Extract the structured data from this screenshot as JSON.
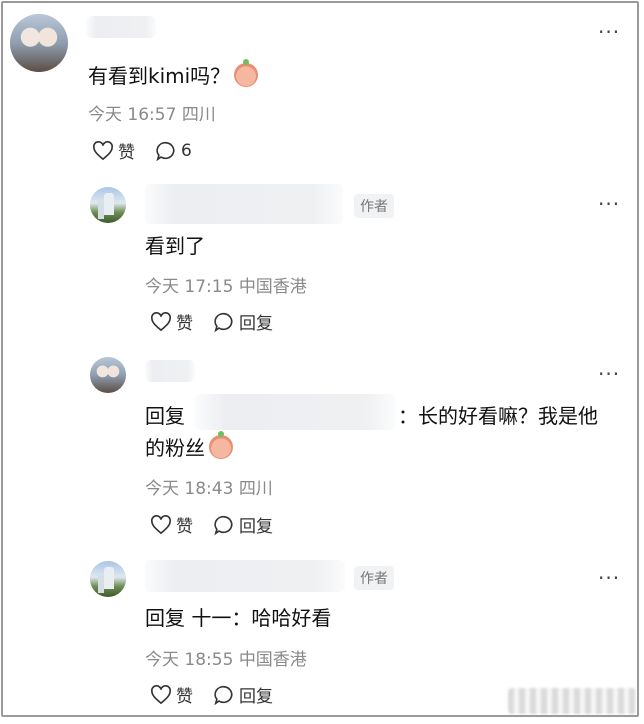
{
  "comments": [
    {
      "text": "有看到kimi吗？",
      "time": "今天 16:57",
      "location": "四川",
      "like_label": "赞",
      "reply_count": "6"
    }
  ],
  "replies": [
    {
      "badge": "作者",
      "text": "看到了",
      "time": "今天 17:15",
      "location": "中国香港",
      "like_label": "赞",
      "reply_label": "回复"
    },
    {
      "prefix": "回复",
      "text_line1_suffix": "：长的好看嘛？我是他",
      "text_line2": "的粉丝",
      "time": "今天 18:43",
      "location": "四川",
      "like_label": "赞",
      "reply_label": "回复"
    },
    {
      "badge": "作者",
      "text": "回复 十一：哈哈好看",
      "time": "今天 18:55",
      "location": "中国香港",
      "like_label": "赞",
      "reply_label": "回复"
    }
  ],
  "more_label": "···",
  "icons": {
    "like": "heart-icon",
    "comment": "comment-bubble-icon",
    "reply": "reply-bubble-icon",
    "more": "more-dots-icon"
  }
}
